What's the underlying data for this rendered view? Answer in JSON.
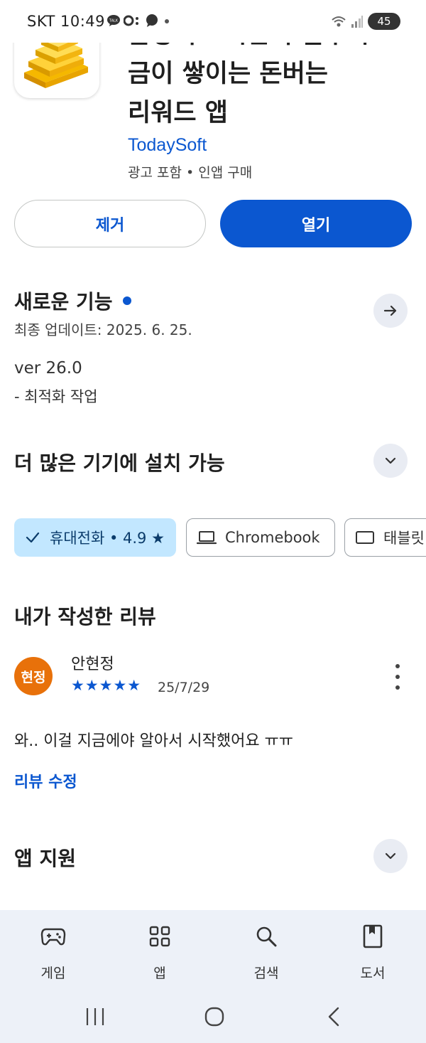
{
  "status_bar": {
    "time": "SKT 10:49",
    "battery": "45"
  },
  "app": {
    "title": "금쌓기 - 시간이 갈수록\n금이 쌓이는 돈버는\n리워드 앱",
    "developer": "TodaySoft",
    "meta": "광고 포함 • 인앱 구매",
    "icon": "gold-bars-icon"
  },
  "buttons": {
    "remove": "제거",
    "open": "열기"
  },
  "whats_new": {
    "title": "새로운 기능",
    "updated": "최종 업데이트: 2025. 6. 25.",
    "version": "ver 26.0",
    "notes": "- 최적화 작업"
  },
  "devices": {
    "title": "더 많은 기기에 설치 가능",
    "chips": [
      {
        "label": "휴대전화 • 4.9 ★",
        "icon": "check-icon",
        "selected": true
      },
      {
        "label": "Chromebook",
        "icon": "laptop-icon",
        "selected": false
      },
      {
        "label": "태블릿",
        "icon": "tablet-icon",
        "selected": false
      }
    ]
  },
  "my_review": {
    "title": "내가 작성한 리뷰",
    "avatar_text": "현정",
    "reviewer": "안현정",
    "stars": "★★★★★",
    "rating": 5,
    "date": "25/7/29",
    "body": "와.. 이걸 지금에야 알아서 시작했어요 ㅠㅠ",
    "edit_label": "리뷰 수정"
  },
  "app_support": {
    "title": "앱 지원"
  },
  "bottom_nav": {
    "items": [
      {
        "label": "게임",
        "icon": "gamepad-icon"
      },
      {
        "label": "앱",
        "icon": "apps-grid-icon"
      },
      {
        "label": "검색",
        "icon": "search-icon"
      },
      {
        "label": "도서",
        "icon": "book-icon"
      }
    ]
  },
  "colors": {
    "accent": "#0b57d0",
    "chip_selected_bg": "#c2e7ff",
    "avatar_bg": "#e8710a",
    "nav_bg": "#edf1f8"
  }
}
